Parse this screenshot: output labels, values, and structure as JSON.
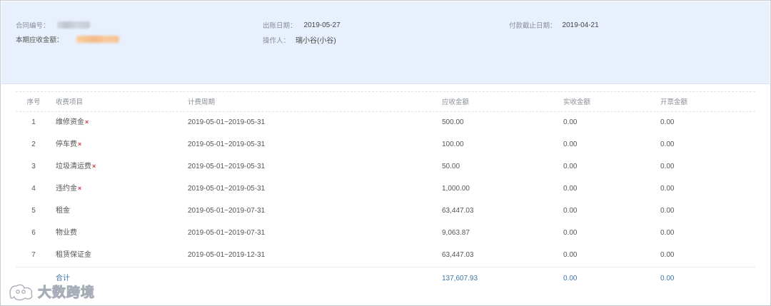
{
  "header": {
    "contract_no_label": "合同编号：",
    "bill_date_label": "出账日期：",
    "bill_date_value": "2019-05-27",
    "due_date_label": "付款截止日期：",
    "due_date_value": "2019-04-21",
    "amount_due_label": "本期应收金额：",
    "operator_label": "操作人：",
    "operator_value": "瑞小谷(小谷)"
  },
  "table": {
    "columns": [
      "序号",
      "收费项目",
      "计费周期",
      "应收金额",
      "实收金额",
      "开票金额"
    ],
    "rows": [
      {
        "index": "1",
        "item": "维修资金",
        "period": "2019-05-01~2019-05-31",
        "due": "500.00",
        "received": "0.00",
        "invoiced": "0.00",
        "removable": true
      },
      {
        "index": "2",
        "item": "停车费",
        "period": "2019-05-01~2019-05-31",
        "due": "100.00",
        "received": "0.00",
        "invoiced": "0.00",
        "removable": true
      },
      {
        "index": "3",
        "item": "垃圾清运费",
        "period": "2019-05-01~2019-05-31",
        "due": "50.00",
        "received": "0.00",
        "invoiced": "0.00",
        "removable": true
      },
      {
        "index": "4",
        "item": "违约金",
        "period": "2019-05-01~2019-05-31",
        "due": "1,000.00",
        "received": "0.00",
        "invoiced": "0.00",
        "removable": true
      },
      {
        "index": "5",
        "item": "租金",
        "period": "2019-05-01~2019-07-31",
        "due": "63,447.03",
        "received": "0.00",
        "invoiced": "0.00",
        "removable": false
      },
      {
        "index": "6",
        "item": "物业费",
        "period": "2019-05-01~2019-07-31",
        "due": "9,063.87",
        "received": "0.00",
        "invoiced": "0.00",
        "removable": false
      },
      {
        "index": "7",
        "item": "租赁保证金",
        "period": "2019-05-01~2019-12-31",
        "due": "63,447.03",
        "received": "0.00",
        "invoiced": "0.00",
        "removable": false
      }
    ],
    "total": {
      "label": "合计",
      "due": "137,607.93",
      "received": "0.00",
      "invoiced": "0.00"
    }
  },
  "remove_icon": "×",
  "watermark": {
    "text": "大数跨境"
  },
  "colors": {
    "header_bg": "#e8f0fd",
    "remove_icon": "#d9363e",
    "total_text": "#3f74a8"
  }
}
